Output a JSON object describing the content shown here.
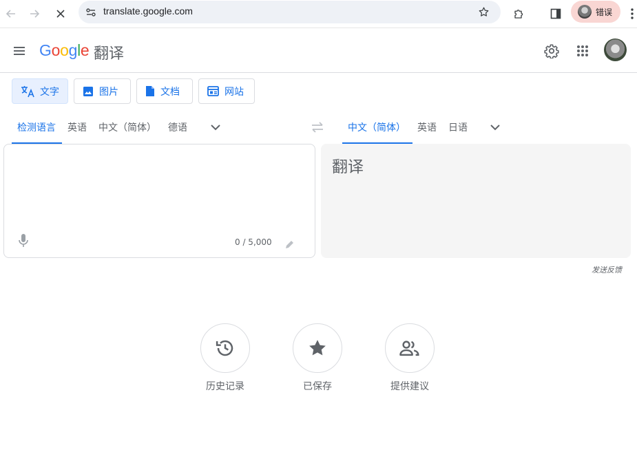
{
  "browser": {
    "url": "translate.google.com",
    "profile_label": "错误"
  },
  "header": {
    "logo_letters": [
      "G",
      "o",
      "o",
      "g",
      "l",
      "e"
    ],
    "logo_colors": [
      "#4285f4",
      "#ea4335",
      "#fbbc05",
      "#4285f4",
      "#34a853",
      "#ea4335"
    ],
    "title_suffix": "翻译"
  },
  "modes": [
    {
      "label": "文字",
      "icon": "translate-icon",
      "active": true
    },
    {
      "label": "图片",
      "icon": "image-icon",
      "active": false
    },
    {
      "label": "文档",
      "icon": "document-icon",
      "active": false
    },
    {
      "label": "网站",
      "icon": "website-icon",
      "active": false
    }
  ],
  "source_langs": [
    {
      "label": "检测语言",
      "active": true
    },
    {
      "label": "英语",
      "active": false
    },
    {
      "label": "中文（简体）",
      "active": false
    },
    {
      "label": "德语",
      "active": false
    }
  ],
  "target_langs": [
    {
      "label": "中文（简体）",
      "active": true
    },
    {
      "label": "英语",
      "active": false
    },
    {
      "label": "日语",
      "active": false
    }
  ],
  "source": {
    "text": "",
    "char_count": "0 / 5,000"
  },
  "target": {
    "text": "翻译"
  },
  "feedback_label": "发送反馈",
  "actions": [
    {
      "label": "历史记录",
      "icon": "history-icon"
    },
    {
      "label": "已保存",
      "icon": "star-icon"
    },
    {
      "label": "提供建议",
      "icon": "community-icon"
    }
  ],
  "colors": {
    "accent": "#1a73e8",
    "active_tab_bg": "#e8f0fe",
    "target_panel_bg": "#f5f5f5"
  }
}
